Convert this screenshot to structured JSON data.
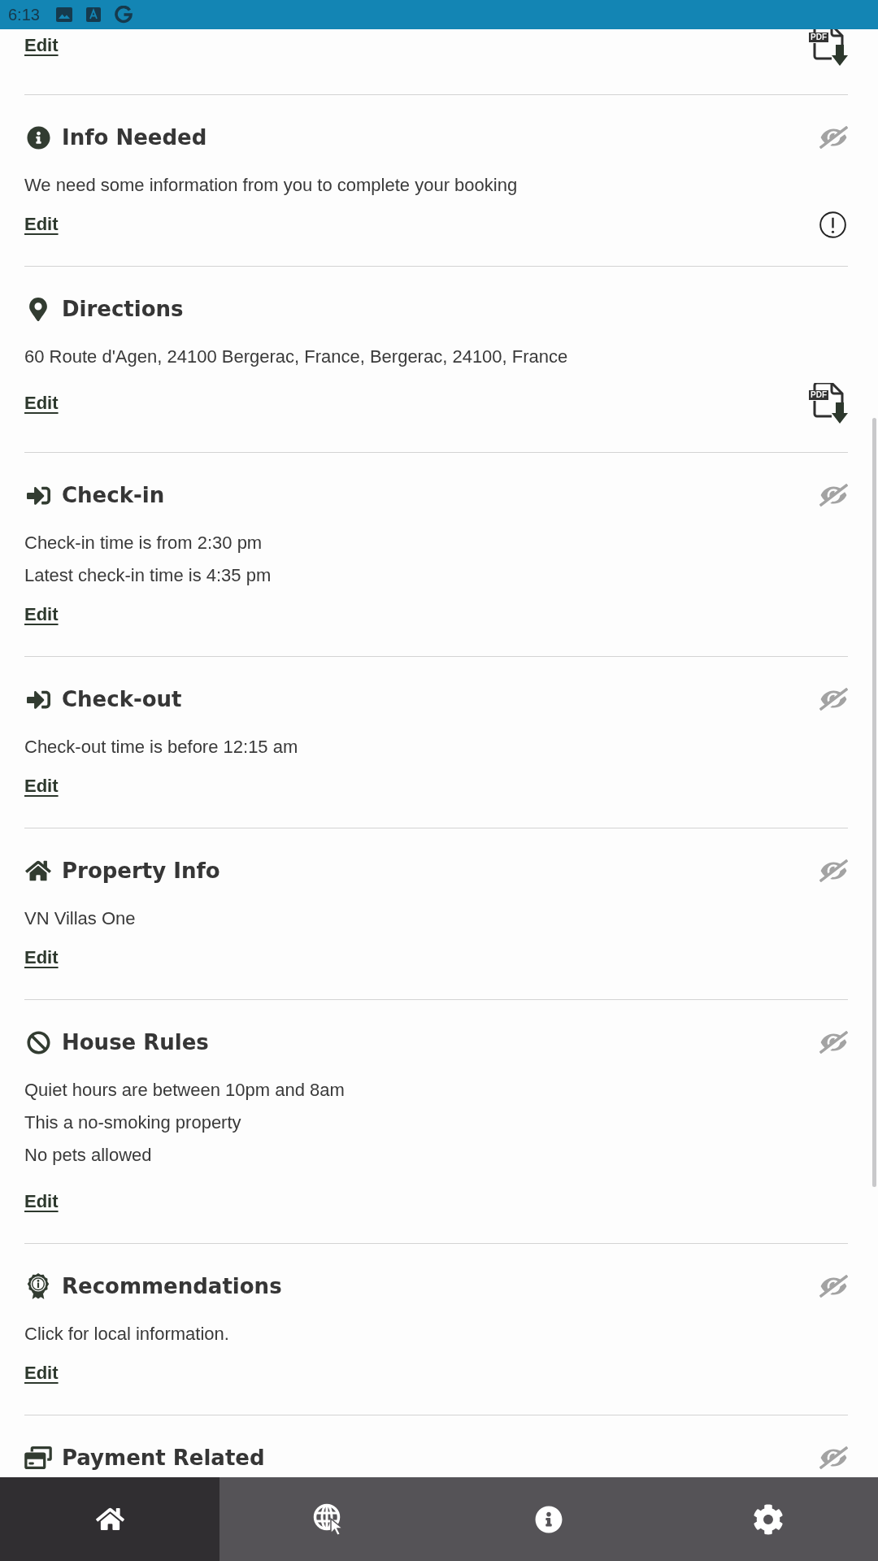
{
  "status_bar": {
    "time": "6:13"
  },
  "sections": [
    {
      "kind": "attachment",
      "edit": "Edit",
      "pdf_label": "PDF"
    },
    {
      "kind": "info",
      "title": "Info Needed",
      "hidden": true,
      "lines": [
        "We need some information from you to complete your booking"
      ],
      "edit": "Edit"
    },
    {
      "kind": "directions",
      "title": "Directions",
      "lines": [
        "60 Route d'Agen, 24100 Bergerac, France, Bergerac, 24100, France"
      ],
      "edit": "Edit",
      "pdf_label": "PDF"
    },
    {
      "kind": "checkin",
      "title": "Check-in",
      "hidden": true,
      "lines": [
        "Check-in time is from 2:30 pm",
        "Latest check-in time is 4:35 pm"
      ],
      "edit": "Edit"
    },
    {
      "kind": "checkout",
      "title": "Check-out",
      "hidden": true,
      "lines": [
        "Check-out time is before 12:15 am"
      ],
      "edit": "Edit"
    },
    {
      "kind": "property",
      "title": "Property Info",
      "hidden": true,
      "lines": [
        "VN Villas One"
      ],
      "edit": "Edit"
    },
    {
      "kind": "rules",
      "title": "House Rules",
      "hidden": true,
      "lines": [
        "Quiet hours are between 10pm and 8am",
        "This a no-smoking property",
        "No pets allowed"
      ],
      "edit": "Edit"
    },
    {
      "kind": "recommendations",
      "title": "Recommendations",
      "hidden": true,
      "lines": [
        "Click for local information."
      ],
      "edit": "Edit"
    },
    {
      "kind": "payment",
      "title": "Payment Related",
      "hidden": true
    }
  ],
  "nav": [
    {
      "kind": "home",
      "selected": true
    },
    {
      "kind": "web",
      "selected": false
    },
    {
      "kind": "info",
      "selected": false
    },
    {
      "kind": "settings",
      "selected": false
    }
  ]
}
